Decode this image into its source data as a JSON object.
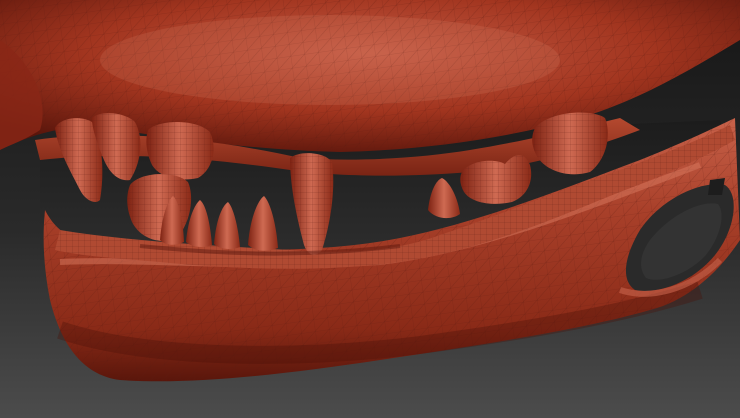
{
  "viewport": {
    "subject": "sculpted-skull-jaw",
    "background_top": "#1a1a1a",
    "background_bottom": "#4a4a4a",
    "material_base": "#a2351f",
    "material_highlight": "#d9705a",
    "material_shadow": "#3e0d07",
    "wireframe_color": "#5a1a10"
  }
}
